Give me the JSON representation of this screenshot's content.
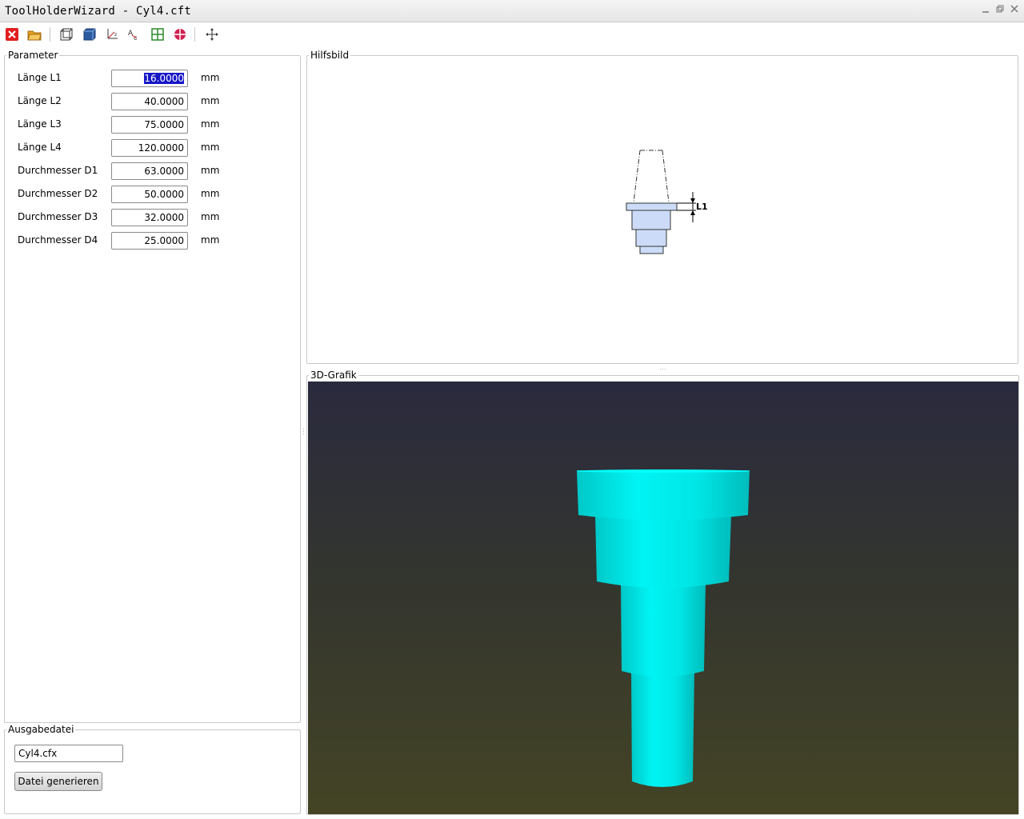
{
  "window": {
    "title": "ToolHolderWizard - Cyl4.cft",
    "controls": [
      "minimize-icon",
      "restore-icon",
      "close-icon"
    ]
  },
  "toolbar": {
    "items": [
      {
        "name": "close-file-icon",
        "color": "#e02020"
      },
      {
        "name": "open-folder-icon",
        "color": "#e8a020"
      },
      {
        "name": "wireframe-view-icon",
        "color": "#333333"
      },
      {
        "name": "solid-view-icon",
        "color": "#2a5aa0"
      },
      {
        "name": "axes-icon",
        "color": "#333333"
      },
      {
        "name": "labels-icon",
        "color": "#333333"
      },
      {
        "name": "grid-icon",
        "color": "#2a8a2a"
      },
      {
        "name": "center-icon",
        "color": "#d02050"
      },
      {
        "name": "pan-icon",
        "color": "#333333"
      }
    ]
  },
  "parameter": {
    "title": "Parameter",
    "rows": [
      {
        "label": "Länge L1",
        "value": "16.0000",
        "unit": "mm",
        "selected": true
      },
      {
        "label": "Länge L2",
        "value": "40.0000",
        "unit": "mm"
      },
      {
        "label": "Länge L3",
        "value": "75.0000",
        "unit": "mm"
      },
      {
        "label": "Länge L4",
        "value": "120.0000",
        "unit": "mm"
      },
      {
        "label": "Durchmesser D1",
        "value": "63.0000",
        "unit": "mm"
      },
      {
        "label": "Durchmesser D2",
        "value": "50.0000",
        "unit": "mm"
      },
      {
        "label": "Durchmesser D3",
        "value": "32.0000",
        "unit": "mm"
      },
      {
        "label": "Durchmesser D4",
        "value": "25.0000",
        "unit": "mm"
      }
    ]
  },
  "output": {
    "title": "Ausgabedatei",
    "filename": "Cyl4.cfx",
    "generate_label": "Datei generieren"
  },
  "help": {
    "title": "Hilfsbild",
    "dimension_label": "L1",
    "fill_color": "#ccdcf8"
  },
  "view3d": {
    "title": "3D-Grafik",
    "model_color": "#00f0f0"
  }
}
